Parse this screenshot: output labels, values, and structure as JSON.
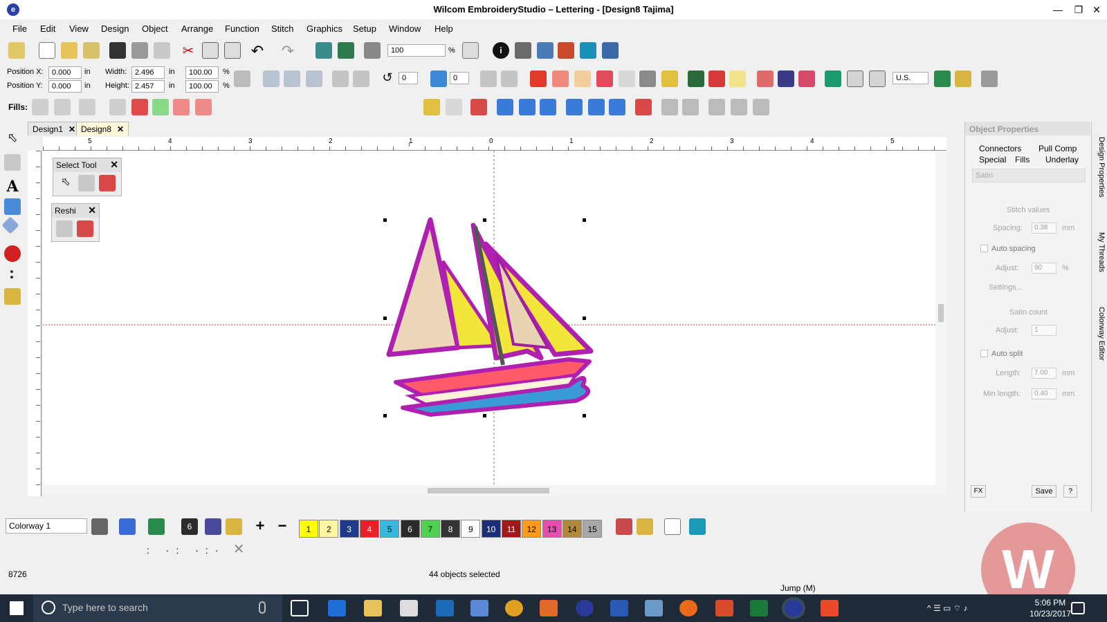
{
  "window": {
    "title": "Wilcom EmbroideryStudio – Lettering - [Design8        Tajima]"
  },
  "menu": [
    "File",
    "Edit",
    "View",
    "Design",
    "Object",
    "Arrange",
    "Function",
    "Stitch",
    "Graphics",
    "Setup",
    "Window",
    "Help"
  ],
  "toolbar": {
    "zoom_value": "100",
    "zoom_unit": "%"
  },
  "position": {
    "x_label": "Position X:",
    "x_value": "0.000",
    "y_label": "Position Y:",
    "y_value": "0.000",
    "width_label": "Width:",
    "width_value": "2.496",
    "height_label": "Height:",
    "height_value": "2.457",
    "unit": "in",
    "width_pct": "100.00",
    "height_pct": "100.00",
    "pct": "%",
    "rotate_value": "0",
    "slant_value": "0",
    "units_select": "U.S."
  },
  "fills_label": "Fills:",
  "doc_tabs": [
    {
      "label": "Design1"
    },
    {
      "label": "Design8"
    }
  ],
  "ruler": {
    "labels": [
      "5",
      "4",
      "3",
      "2",
      "1",
      "0",
      "1",
      "2",
      "3",
      "4",
      "5"
    ]
  },
  "float_panels": {
    "select_tool": "Select Tool",
    "reshape": "Reshi"
  },
  "object_properties": {
    "title": "Object Properties",
    "tabs": [
      "Connectors",
      "Pull Comp",
      "Special",
      "Fills",
      "Underlay"
    ],
    "fill_type": "Satin",
    "stitch_values": "Stitch values",
    "spacing_label": "Spacing:",
    "spacing_value": "0.38",
    "mm": "mm",
    "auto_spacing": "Auto spacing",
    "adjust_label": "Adjust:",
    "adjust_value": "90",
    "adjust_unit": "%",
    "settings": "Settings...",
    "satin_count": "Satin count",
    "satin_adjust_value": "1",
    "auto_split": "Auto split",
    "length_label": "Length:",
    "length_value": "7.00",
    "min_length_label": "Min length:",
    "min_length_value": "0.40",
    "fx": "FX",
    "save": "Save",
    "help": "?"
  },
  "side_tabs": [
    "Design Properties",
    "My Threads",
    "Colorway Editor"
  ],
  "colorway": {
    "select": "Colorway 1",
    "current_color": "6",
    "swatches": [
      {
        "n": "1",
        "color": "#ffff00"
      },
      {
        "n": "2",
        "color": "#fff6a0"
      },
      {
        "n": "3",
        "color": "#1f3a8a"
      },
      {
        "n": "4",
        "color": "#e8202a"
      },
      {
        "n": "5",
        "color": "#36b8e0"
      },
      {
        "n": "6",
        "color": "#2b2b2b"
      },
      {
        "n": "7",
        "color": "#4fd24f"
      },
      {
        "n": "8",
        "color": "#333333"
      },
      {
        "n": "9",
        "color": "#ffffff"
      },
      {
        "n": "10",
        "color": "#1c2f7a"
      },
      {
        "n": "11",
        "color": "#a01818"
      },
      {
        "n": "12",
        "color": "#ff9a1a"
      },
      {
        "n": "13",
        "color": "#e64fb0"
      },
      {
        "n": "14",
        "color": "#b08a3a"
      },
      {
        "n": "15",
        "color": "#a8a8a8"
      }
    ]
  },
  "status": {
    "stitch_count": "8726",
    "selection": "44 objects selected",
    "jump": "Jump (M)"
  },
  "taskbar": {
    "search_placeholder": "Type here to search",
    "time": "5:06 PM",
    "date": "10/23/2017"
  }
}
